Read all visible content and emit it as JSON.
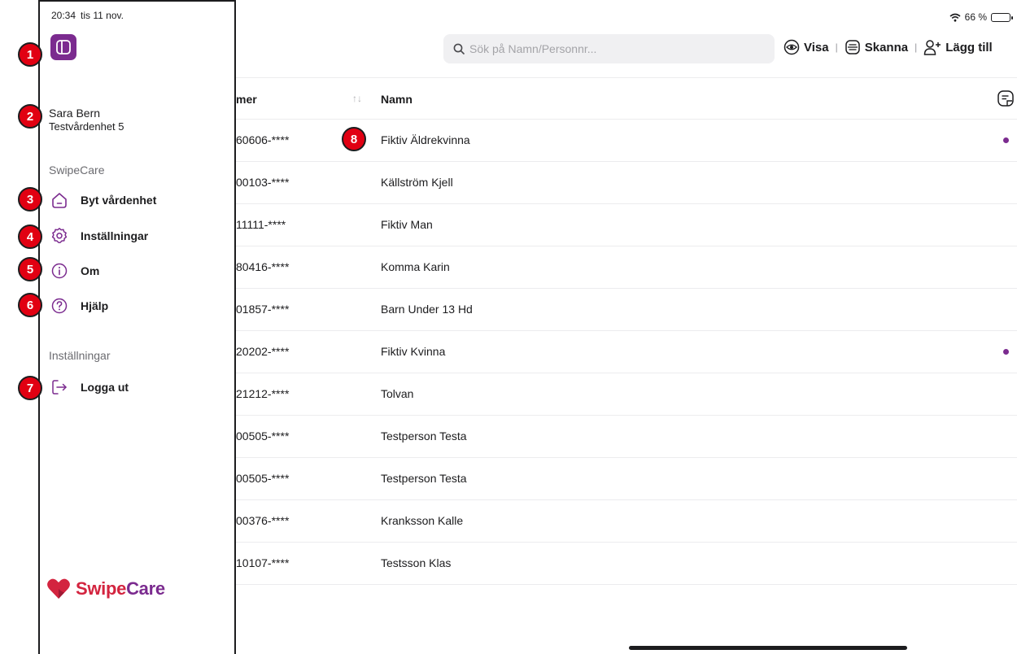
{
  "status_bar": {
    "time": "20:34",
    "date": "tis 11 nov.",
    "battery": "66 %",
    "battery_level": 0.66
  },
  "search": {
    "placeholder": "Sök på Namn/Personnr..."
  },
  "toolbar": {
    "visa_label": "Visa",
    "skanna_label": "Skanna",
    "lagg_till_label": "Lägg till",
    "separator": "|"
  },
  "table": {
    "header_pnr": "mer",
    "header_name": "Namn",
    "rows": [
      {
        "pnr": "60606-****",
        "name": "Fiktiv Äldrekvinna",
        "dot": true
      },
      {
        "pnr": "00103-****",
        "name": "Källström Kjell",
        "dot": false
      },
      {
        "pnr": "11111-****",
        "name": "Fiktiv Man",
        "dot": false
      },
      {
        "pnr": "80416-****",
        "name": "Komma Karin",
        "dot": false
      },
      {
        "pnr": "01857-****",
        "name": "Barn Under 13 Hd",
        "dot": false
      },
      {
        "pnr": "20202-****",
        "name": "Fiktiv Kvinna",
        "dot": true
      },
      {
        "pnr": "21212-****",
        "name": "Tolvan",
        "dot": false
      },
      {
        "pnr": "00505-****",
        "name": "Testperson Testa",
        "dot": false
      },
      {
        "pnr": "00505-****",
        "name": "Testperson Testa",
        "dot": false
      },
      {
        "pnr": "00376-****",
        "name": "Kranksson Kalle",
        "dot": false
      },
      {
        "pnr": "10107-****",
        "name": "Testsson Klas",
        "dot": false
      }
    ]
  },
  "sidebar": {
    "user_name": "Sara Bern",
    "user_unit": "Testvårdenhet 5",
    "section_app": "SwipeCare",
    "section_settings": "Inställningar",
    "items": [
      {
        "label": "Byt vårdenhet",
        "icon": "home-icon"
      },
      {
        "label": "Inställningar",
        "icon": "gear-icon"
      },
      {
        "label": "Om",
        "icon": "info-icon"
      },
      {
        "label": "Hjälp",
        "icon": "help-icon"
      },
      {
        "label": "Logga ut",
        "icon": "logout-icon"
      }
    ],
    "logo": {
      "part1": "Swipe",
      "part2": "Care"
    }
  },
  "markers": [
    "1",
    "2",
    "3",
    "4",
    "5",
    "6",
    "7",
    "8"
  ],
  "colors": {
    "accent": "#7b2b8f",
    "brand_red": "#d3243f",
    "marker": "#e10012"
  }
}
